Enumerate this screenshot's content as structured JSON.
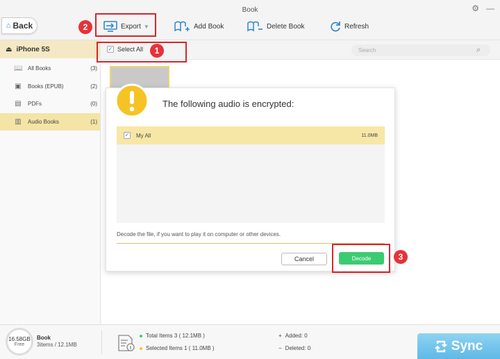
{
  "window": {
    "title": "Book",
    "settings_icon": "gear-icon",
    "minimize_glyph": "—"
  },
  "header": {
    "back_label": "Back",
    "toolbar": {
      "export_label": "Export",
      "add_book_label": "Add Book",
      "delete_book_label": "Delete Book",
      "refresh_label": "Refresh"
    }
  },
  "annotations": {
    "step1": "1",
    "step2": "2",
    "step3": "3"
  },
  "sidebar": {
    "device": "iPhone 5S",
    "items": [
      {
        "label": "All Books",
        "count": "(3)",
        "icon": "book-icon"
      },
      {
        "label": "Books (EPUB)",
        "count": "(2)",
        "icon": "epub-icon"
      },
      {
        "label": "PDFs",
        "count": "(0)",
        "icon": "pdf-icon"
      },
      {
        "label": "Audio Books",
        "count": "(1)",
        "icon": "audio-book-icon",
        "active": true
      }
    ]
  },
  "listbar": {
    "select_all_label": "Select All",
    "search_placeholder": "Search"
  },
  "dialog": {
    "title": "The following audio is encrypted:",
    "items": [
      {
        "name": "My All",
        "size": "11.0MB",
        "checked": true
      }
    ],
    "note": "Decode the file, if you want to play it on computer or other devices.",
    "cancel_label": "Cancel",
    "decode_label": "Decode"
  },
  "status": {
    "storage_free": "16.58GB",
    "free_label": "Free",
    "device_label": "Book",
    "device_info": "3items / 12.1MB",
    "total_items": "Total Items 3 ( 12.1MB )",
    "selected_items": "Selected Items 1 ( 11.0MB )",
    "added": "Added: 0",
    "deleted": "Deleted: 0",
    "sync_label": "Sync"
  },
  "colors": {
    "highlight": "#d9252b",
    "accent_blue": "#2f86c9",
    "decode_green": "#3ccb73",
    "row_yellow": "#f7e7a7"
  }
}
